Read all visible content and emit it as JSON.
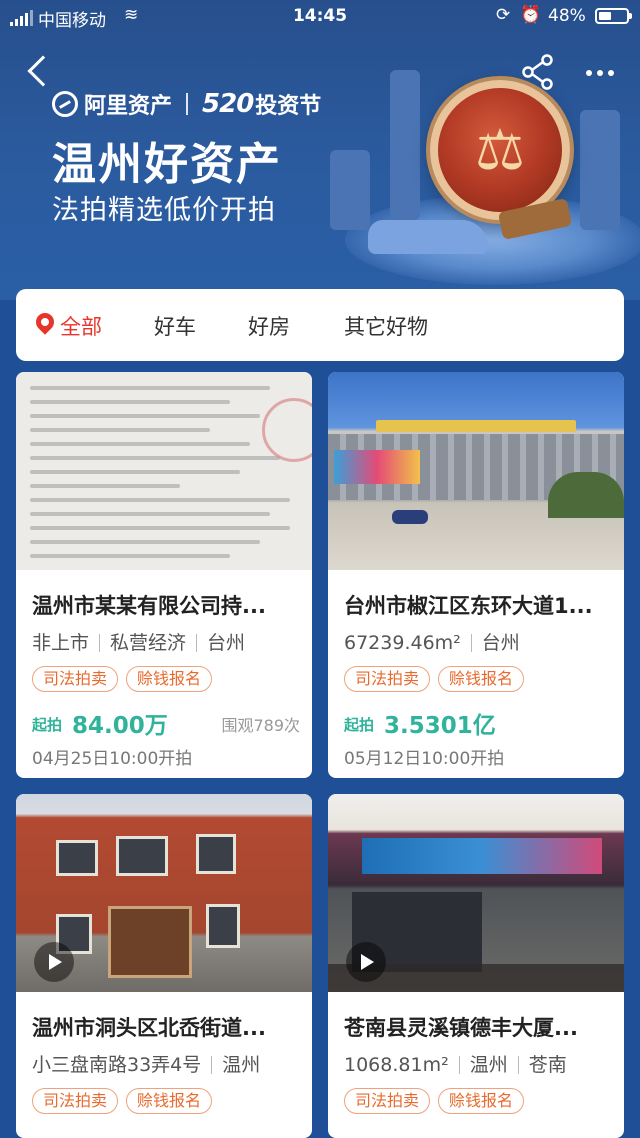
{
  "status_bar": {
    "carrier": "中国移动",
    "time": "14:45",
    "battery": "48%",
    "battery_level": 0.48
  },
  "header": {
    "logo_brand": "阿里资产",
    "logo_event_mark": "520",
    "logo_event_text": "投资节",
    "title": "温州好资产",
    "subtitle": "法拍精选低价开拍"
  },
  "tabs": [
    {
      "label": "全部",
      "active": true
    },
    {
      "label": "好车",
      "active": false
    },
    {
      "label": "好房",
      "active": false
    },
    {
      "label": "其它好物",
      "active": false
    }
  ],
  "listings": [
    {
      "title": "温州市某某有限公司持...",
      "meta": [
        "非上市",
        "私营经济",
        "台州"
      ],
      "tags": [
        "司法拍卖",
        "赊钱报名"
      ],
      "price_label": "起拍",
      "price": "84.00万",
      "views": "围观789次",
      "start_time": "04月25日10:00开拍",
      "has_video": false
    },
    {
      "title": "台州市椒江区东环大道1...",
      "meta": [
        "67239.46m²",
        "台州"
      ],
      "tags": [
        "司法拍卖",
        "赊钱报名"
      ],
      "price_label": "起拍",
      "price": "3.5301亿",
      "views": "",
      "start_time": "05月12日10:00开拍",
      "has_video": false
    },
    {
      "title": "温州市洞头区北岙街道...",
      "meta": [
        "小三盘南路33弄4号",
        "温州"
      ],
      "tags": [
        "司法拍卖",
        "赊钱报名"
      ],
      "has_video": true
    },
    {
      "title": "苍南县灵溪镇德丰大厦...",
      "meta": [
        "1068.81m²",
        "温州",
        "苍南"
      ],
      "tags": [
        "司法拍卖",
        "赊钱报名"
      ],
      "has_video": true
    }
  ],
  "colors": {
    "accent_red": "#e8352b",
    "price_green": "#2fb39a",
    "tag_orange": "#e86a2e",
    "hero_blue": "#2b5b9f"
  }
}
